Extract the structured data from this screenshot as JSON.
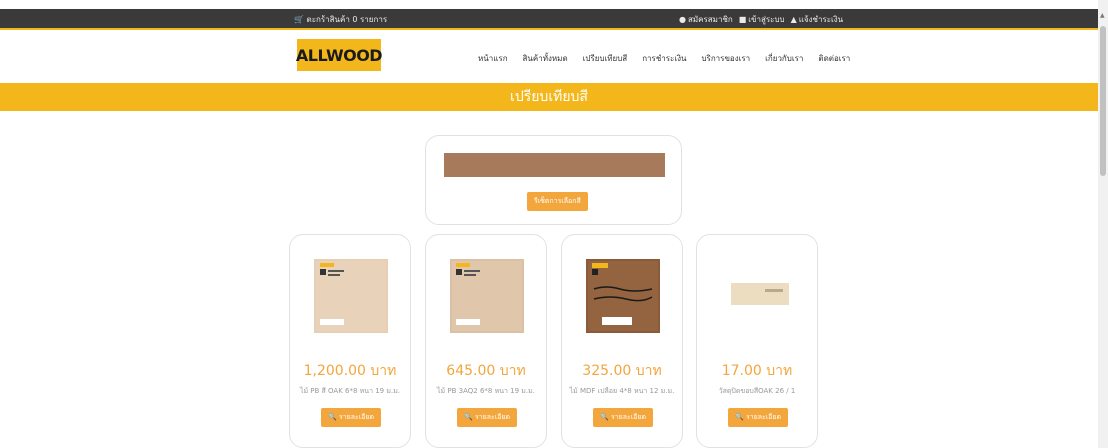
{
  "topbar": {
    "cart_label": "ตะกร้าสินค้า 0 รายการ",
    "register_label": "สมัครสมาชิก",
    "login_label": "เข้าสู่ระบบ",
    "notify_label": "แจ้งชำระเงิน"
  },
  "header": {
    "logo_text": "ALLWOOD",
    "nav": [
      "หน้าแรก",
      "สินค้าทั้งหมด",
      "เปรียบเทียบสี",
      "การชำระเงิน",
      "บริการของเรา",
      "เกี่ยวกับเรา",
      "ติดต่อเรา"
    ]
  },
  "banner": {
    "title": "เปรียบเทียบสี"
  },
  "color_compare": {
    "swatch_color": "#a87a5c",
    "button_label": "รีเซ็ตการเลือกสี"
  },
  "products": [
    {
      "price": "1,200.00 บาท",
      "name": "ไม้ PB สี OAK 6*8 หนา 19 ม.ม.",
      "button": "รายละเอียด"
    },
    {
      "price": "645.00 บาท",
      "name": "ไม้ PB 3AQ2 6*8 หนา 19 ม.ม.",
      "button": "รายละเอียด"
    },
    {
      "price": "325.00 บาท",
      "name": "ไม้ MDF เปลือย 4*8 หนา 12 ม.ม.",
      "button": "รายละเอียด"
    },
    {
      "price": "17.00 บาท",
      "name": "วัสดุปิดขอบสีOAK 26 / 1",
      "button": "รายละเอียด"
    }
  ],
  "colors": {
    "accent": "#f3b71c",
    "button": "#f3a63c",
    "topbar": "#3a3a3a"
  }
}
